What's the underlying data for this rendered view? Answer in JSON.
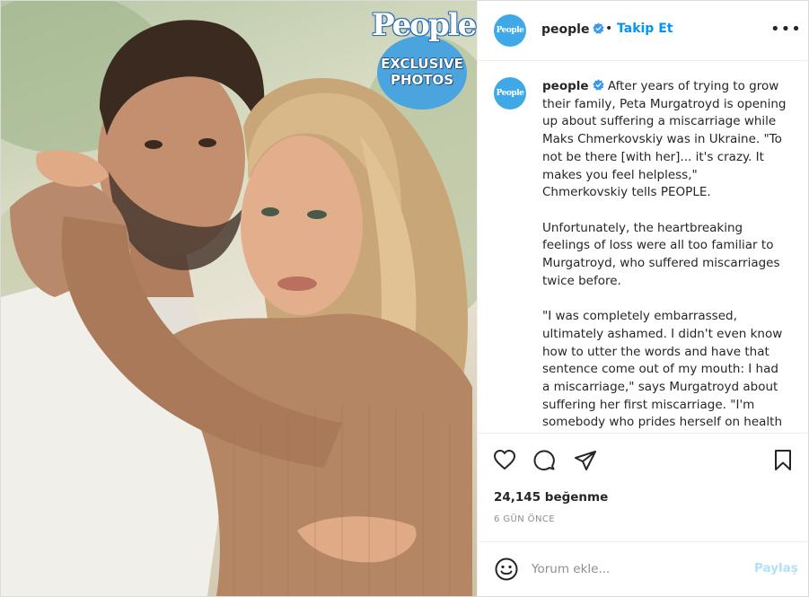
{
  "photo": {
    "brand_logo": "People",
    "badge_line1": "EXCLUSIVE",
    "badge_line2": "PHOTOS"
  },
  "header": {
    "avatar_text": "People",
    "username": "people",
    "separator": "•",
    "follow_label": "Takip Et",
    "more_label": "•••"
  },
  "caption": {
    "avatar_text": "People",
    "username": "people",
    "paragraph1": "After years of trying to grow their family, Peta Murgatroyd is opening up about suffering a miscarriage while Maks Chmerkovskiy was in Ukraine. \"To not be there [with her]... it's crazy. It makes you feel helpless,\" Chmerkovskiy tells PEOPLE.",
    "paragraph2": "Unfortunately, the heartbreaking feelings of loss were all too familiar to Murgatroyd, who suffered miscarriages twice before.",
    "paragraph3": "\"I was completely embarrassed, ultimately ashamed. I didn't even know how to utter the words and have that sentence come out of my mouth: I had a miscarriage,\" says Murgatroyd about suffering her first miscarriage. \"I'm somebody who prides herself on health"
  },
  "actions": {
    "likes": "24,145 beğenme",
    "time": "6 GÜN ÖNCE"
  },
  "comment": {
    "placeholder": "Yorum ekle...",
    "post_label": "Paylaş"
  },
  "colors": {
    "link_blue": "#0095f6",
    "post_disabled": "#b2dffc",
    "avatar_blue": "#3fa8e6",
    "muted_text": "#8e8e8e"
  }
}
